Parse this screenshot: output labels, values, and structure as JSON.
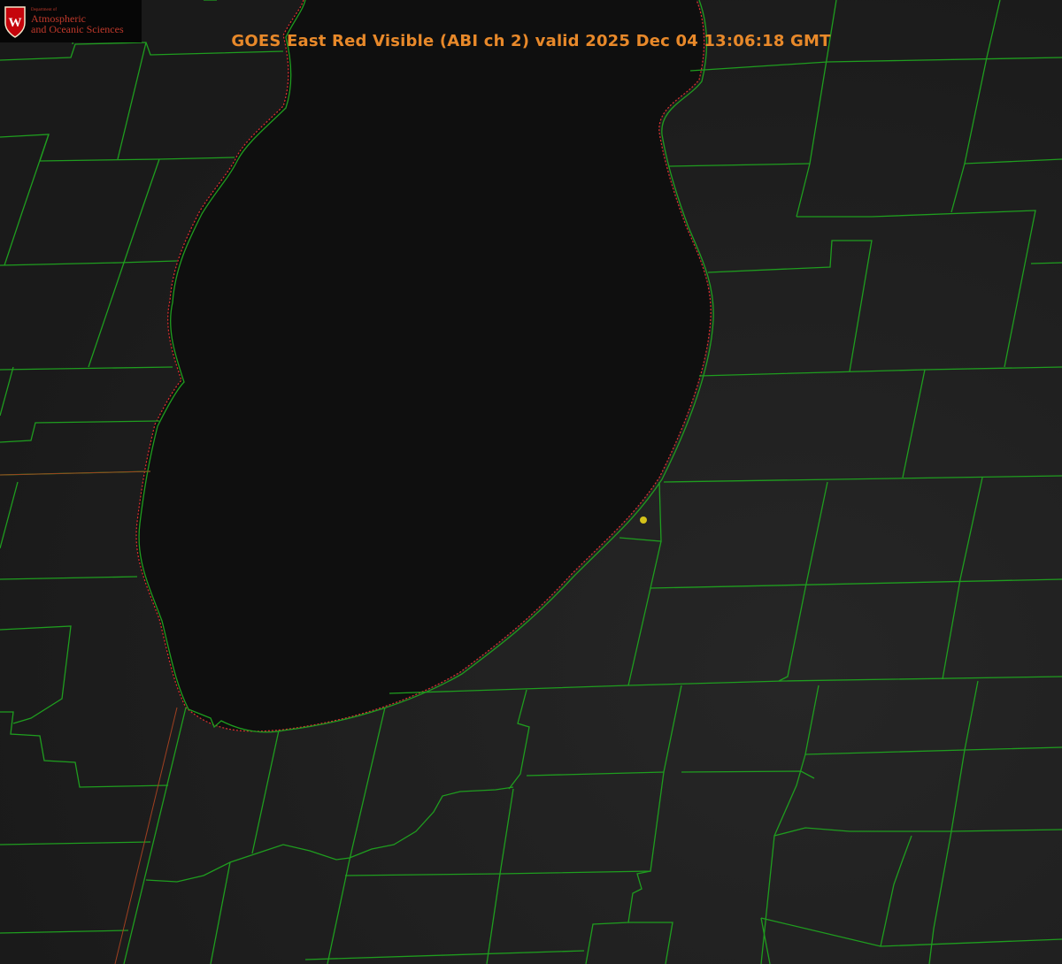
{
  "title": "GOES East Red Visible (ABI ch 2) valid 2025 Dec 04 13:06:18 GMT",
  "logo": {
    "dept": "Department of",
    "line1": "Atmospheric",
    "line2": "and Oceanic Sciences",
    "crest_letter": "W"
  },
  "colors": {
    "county_lines": "#1f9d1f",
    "shoreline_outline": "#e03030",
    "title": "#e8892a",
    "logo_text": "#c0392b",
    "marker": "#d4c21a",
    "land": "#1b1b1b",
    "lake": "#0f0f0f"
  },
  "icons": [
    "uw-crest-icon",
    "location-marker-icon"
  ]
}
